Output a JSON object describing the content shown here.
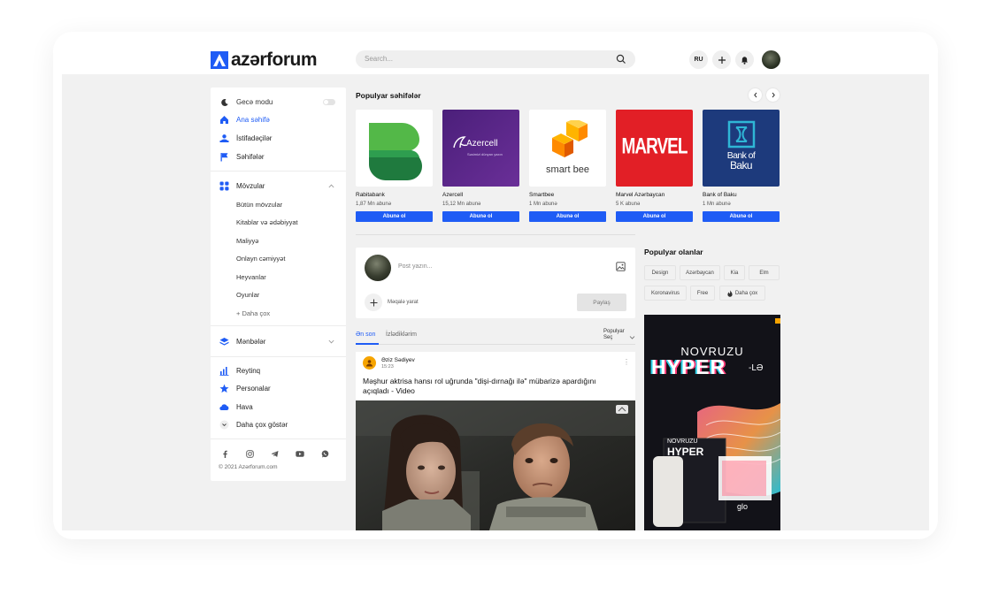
{
  "header": {
    "logo_text": "azərforum",
    "search_placeholder": "Search...",
    "lang": "RU"
  },
  "sidebar": {
    "night_mode": "Gecə modu",
    "nav": [
      {
        "label": "Ana səhifə",
        "active": true
      },
      {
        "label": "İstifadəçilər",
        "active": false
      },
      {
        "label": "Səhifələr",
        "active": false
      }
    ],
    "topics": {
      "label": "Mövzular",
      "items": [
        "Bütün mövzular",
        "Kitablar və ədəbiyyat",
        "Maliyyə",
        "Onlayn cəmiyyət",
        "Heyvanlar",
        "Oyunlar",
        "+ Daha çox"
      ]
    },
    "sources": "Mənbələr",
    "extra": [
      "Reytinq",
      "Personalar",
      "Hava",
      "Daha çox göstər"
    ],
    "copyright": "© 2021 Azərforum.com"
  },
  "popular_pages": {
    "title": "Populyar səhifələr",
    "cards": [
      {
        "name": "Rabitabank",
        "subs": "1,87 Mn abunə",
        "button": "Abunə ol"
      },
      {
        "name": "Azercell",
        "subs": "15,12 Mn abunə",
        "button": "Abunə ol"
      },
      {
        "name": "Smartbee",
        "subs": "1 Mn abunə",
        "button": "Abunə ol"
      },
      {
        "name": "Marvel Azərbaycan",
        "subs": "5 K abunə",
        "button": "Abunə ol"
      },
      {
        "name": "Bank of Baku",
        "subs": "1 Mn abunə",
        "button": "Abunə ol"
      }
    ],
    "logos": {
      "azercell": "Azercell",
      "azercell_tag": "Səsimizi dünyan yaxın",
      "smartbee": "smart bee",
      "marvel": "MARVEL",
      "bank_line1": "Bank of",
      "bank_line2": "Baku"
    }
  },
  "composer": {
    "placeholder": "Post yazın...",
    "article": "Məqalə yarat",
    "share": "Paylaş"
  },
  "feed_tabs": {
    "latest": "Ən son",
    "following": "İzlədiklərim",
    "sort_line1": "Populyar",
    "sort_line2": "Seç"
  },
  "post": {
    "author": "Əziz Sədiyev",
    "time": "15:23",
    "title": "Məşhur aktrisa hansı rol uğrunda \"dişi-dırnağı ilə\" mübarizə apardığını açıqladı - Video"
  },
  "popular_now": {
    "title": "Populyar olanlar",
    "tags": [
      "Design",
      "Azərbaycan",
      "Kia",
      "Elm",
      "Koronavirus",
      "Free",
      "Daha çox"
    ]
  },
  "ad": {
    "line1": "NOVRUZU",
    "line2": "HYPER",
    "suffix": "-LƏ",
    "box_line1": "NOVRUZU",
    "box_line2": "HYPER",
    "brand": "glo"
  },
  "colors": {
    "accent": "#1f5cf5",
    "rabitabank": "#2e9e4f",
    "azercell": "#5b2a8c",
    "marvel": "#e21f26",
    "bank_of_baku": "#1d3a7c"
  }
}
